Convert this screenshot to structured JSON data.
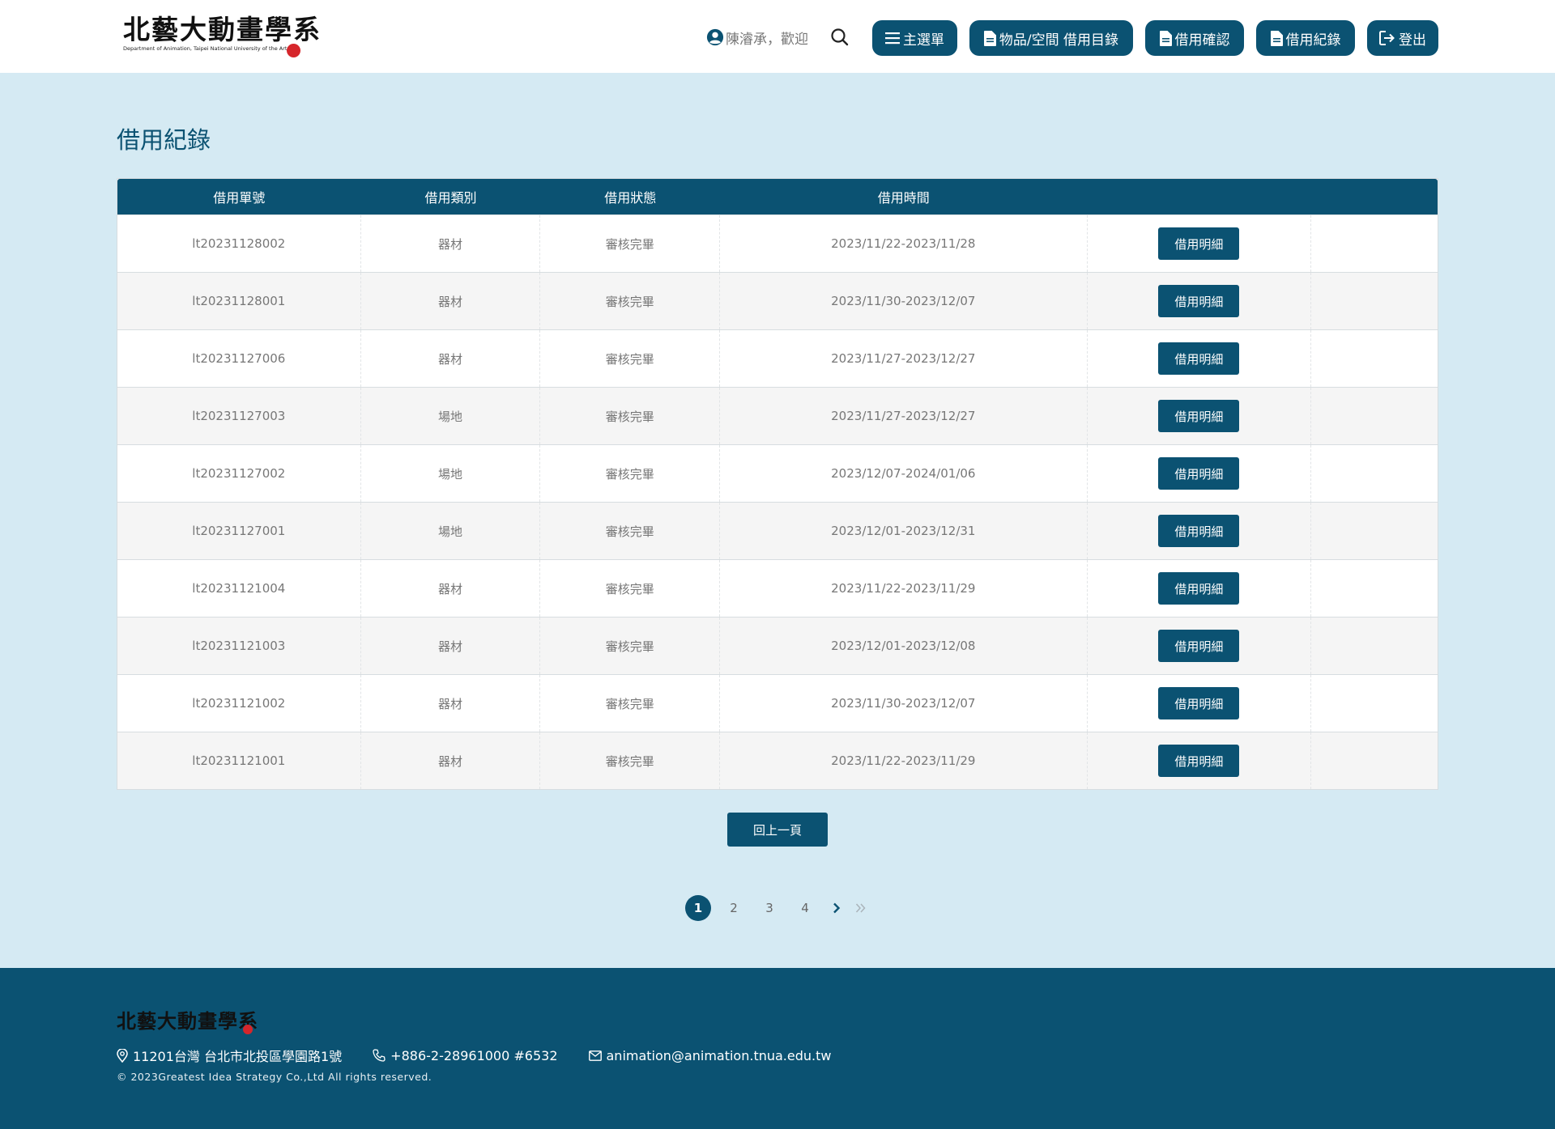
{
  "header": {
    "logo_text": "北藝大動畫學系",
    "logo_sub": "Department of Animation, Taipei National University of the Arts",
    "welcome_text": "陳濬承，歡迎",
    "nav": [
      {
        "label": "主選單",
        "icon": "menu-icon"
      },
      {
        "label": "物品/空間 借用目錄",
        "icon": "document-icon"
      },
      {
        "label": "借用確認",
        "icon": "document-icon"
      },
      {
        "label": "借用紀錄",
        "icon": "document-icon"
      },
      {
        "label": "登出",
        "icon": "logout-icon"
      }
    ]
  },
  "main": {
    "title": "借用紀錄",
    "table": {
      "headers": [
        "借用單號",
        "借用類別",
        "借用狀態",
        "借用時間",
        "",
        ""
      ],
      "detail_label": "借用明細",
      "rows": [
        {
          "id": "lt20231128002",
          "category": "器材",
          "status": "審核完畢",
          "period": "2023/11/22-2023/11/28"
        },
        {
          "id": "lt20231128001",
          "category": "器材",
          "status": "審核完畢",
          "period": "2023/11/30-2023/12/07"
        },
        {
          "id": "lt20231127006",
          "category": "器材",
          "status": "審核完畢",
          "period": "2023/11/27-2023/12/27"
        },
        {
          "id": "lt20231127003",
          "category": "場地",
          "status": "審核完畢",
          "period": "2023/11/27-2023/12/27"
        },
        {
          "id": "lt20231127002",
          "category": "場地",
          "status": "審核完畢",
          "period": "2023/12/07-2024/01/06"
        },
        {
          "id": "lt20231127001",
          "category": "場地",
          "status": "審核完畢",
          "period": "2023/12/01-2023/12/31"
        },
        {
          "id": "lt20231121004",
          "category": "器材",
          "status": "審核完畢",
          "period": "2023/11/22-2023/11/29"
        },
        {
          "id": "lt20231121003",
          "category": "器材",
          "status": "審核完畢",
          "period": "2023/12/01-2023/12/08"
        },
        {
          "id": "lt20231121002",
          "category": "器材",
          "status": "審核完畢",
          "period": "2023/11/30-2023/12/07"
        },
        {
          "id": "lt20231121001",
          "category": "器材",
          "status": "審核完畢",
          "period": "2023/11/22-2023/11/29"
        }
      ]
    },
    "back_label": "回上一頁",
    "pagination": {
      "pages": [
        "1",
        "2",
        "3",
        "4"
      ],
      "current": "1"
    }
  },
  "footer": {
    "logo_text": "北藝大動畫學系",
    "address": "11201台灣 台北市北投區學園路1號",
    "phone": "+886-2-28961000 #6532",
    "email": "animation@animation.tnua.edu.tw",
    "copyright": "© 2023Greatest Idea Strategy Co.,Ltd All rights reserved."
  },
  "colors": {
    "primary": "#0b5272",
    "background": "#d5eaf3",
    "header_bg": "#ffffff"
  }
}
